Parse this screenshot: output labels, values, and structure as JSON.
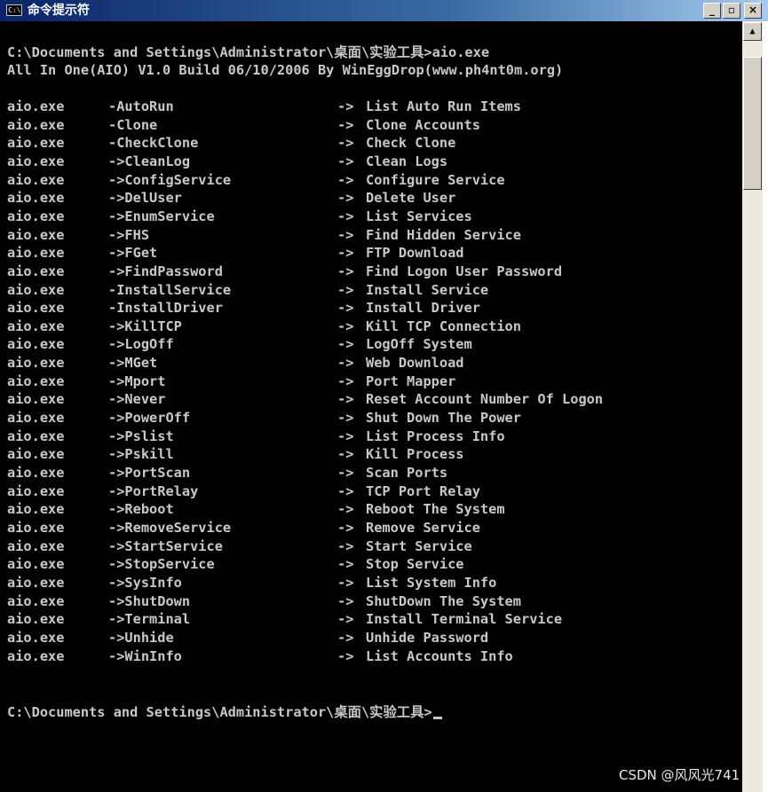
{
  "window": {
    "icon_label": "C:\\",
    "title": "命令提示符",
    "controls": {
      "minimize": "_",
      "maximize": "▫",
      "close": "×"
    }
  },
  "console": {
    "prompt_line_1": "C:\\Documents and Settings\\Administrator\\桌面\\实验工具>aio.exe",
    "banner": "All In One(AIO) V1.0 Build 06/10/2006 By WinEggDrop(www.ph4nt0m.org)",
    "usage": [
      {
        "exe": "aio.exe",
        "cmd": "-AutoRun",
        "arrow": "->",
        "desc": "List Auto Run Items"
      },
      {
        "exe": "aio.exe",
        "cmd": "-Clone",
        "arrow": "->",
        "desc": "Clone Accounts"
      },
      {
        "exe": "aio.exe",
        "cmd": "-CheckClone",
        "arrow": "->",
        "desc": "Check Clone"
      },
      {
        "exe": "aio.exe",
        "cmd": "->CleanLog",
        "arrow": "->",
        "desc": "Clean Logs"
      },
      {
        "exe": "aio.exe",
        "cmd": "->ConfigService",
        "arrow": "->",
        "desc": "Configure Service"
      },
      {
        "exe": "aio.exe",
        "cmd": "->DelUser",
        "arrow": "->",
        "desc": "Delete User"
      },
      {
        "exe": "aio.exe",
        "cmd": "->EnumService",
        "arrow": "->",
        "desc": "List Services"
      },
      {
        "exe": "aio.exe",
        "cmd": "->FHS",
        "arrow": "->",
        "desc": "Find Hidden Service"
      },
      {
        "exe": "aio.exe",
        "cmd": "->FGet",
        "arrow": "->",
        "desc": "FTP Download"
      },
      {
        "exe": "aio.exe",
        "cmd": "->FindPassword",
        "arrow": "->",
        "desc": "Find Logon User Password"
      },
      {
        "exe": "aio.exe",
        "cmd": "-InstallService",
        "arrow": "->",
        "desc": "Install Service"
      },
      {
        "exe": "aio.exe",
        "cmd": "-InstallDriver",
        "arrow": "->",
        "desc": "Install Driver"
      },
      {
        "exe": "aio.exe",
        "cmd": "->KillTCP",
        "arrow": "->",
        "desc": "Kill TCP Connection"
      },
      {
        "exe": "aio.exe",
        "cmd": "->LogOff",
        "arrow": "->",
        "desc": "LogOff System"
      },
      {
        "exe": "aio.exe",
        "cmd": "->MGet",
        "arrow": "->",
        "desc": "Web Download"
      },
      {
        "exe": "aio.exe",
        "cmd": "->Mport",
        "arrow": "->",
        "desc": "Port Mapper"
      },
      {
        "exe": "aio.exe",
        "cmd": "->Never",
        "arrow": "->",
        "desc": "Reset Account Number Of Logon"
      },
      {
        "exe": "aio.exe",
        "cmd": "->PowerOff",
        "arrow": "->",
        "desc": "Shut Down The Power"
      },
      {
        "exe": "aio.exe",
        "cmd": "->Pslist",
        "arrow": "->",
        "desc": "List Process Info"
      },
      {
        "exe": "aio.exe",
        "cmd": "->Pskill",
        "arrow": "->",
        "desc": "Kill Process"
      },
      {
        "exe": "aio.exe",
        "cmd": "->PortScan",
        "arrow": "->",
        "desc": "Scan Ports"
      },
      {
        "exe": "aio.exe",
        "cmd": "->PortRelay",
        "arrow": "->",
        "desc": "TCP Port Relay"
      },
      {
        "exe": "aio.exe",
        "cmd": "->Reboot",
        "arrow": "->",
        "desc": "Reboot The System"
      },
      {
        "exe": "aio.exe",
        "cmd": "->RemoveService",
        "arrow": "->",
        "desc": "Remove Service"
      },
      {
        "exe": "aio.exe",
        "cmd": "->StartService",
        "arrow": "->",
        "desc": "Start Service"
      },
      {
        "exe": "aio.exe",
        "cmd": "->StopService",
        "arrow": "->",
        "desc": "Stop Service"
      },
      {
        "exe": "aio.exe",
        "cmd": "->SysInfo",
        "arrow": "->",
        "desc": "List System Info"
      },
      {
        "exe": "aio.exe",
        "cmd": "->ShutDown",
        "arrow": "->",
        "desc": "ShutDown The System"
      },
      {
        "exe": "aio.exe",
        "cmd": "->Terminal",
        "arrow": "->",
        "desc": "Install Terminal Service"
      },
      {
        "exe": "aio.exe",
        "cmd": "->Unhide",
        "arrow": "->",
        "desc": "Unhide Password"
      },
      {
        "exe": "aio.exe",
        "cmd": "->WinInfo",
        "arrow": "->",
        "desc": "List Accounts Info"
      }
    ],
    "prompt_line_2": "C:\\Documents and Settings\\Administrator\\桌面\\实验工具>"
  },
  "scrollbar": {
    "up_arrow": "▲"
  },
  "watermark": "CSDN @风风光741",
  "colors": {
    "console_bg": "#000000",
    "console_text": "#c8c8c8",
    "titlebar": "#0a246a"
  },
  "icons": [
    "cmd-app-icon",
    "minimize-icon",
    "maximize-icon",
    "close-icon",
    "scroll-up-icon"
  ]
}
